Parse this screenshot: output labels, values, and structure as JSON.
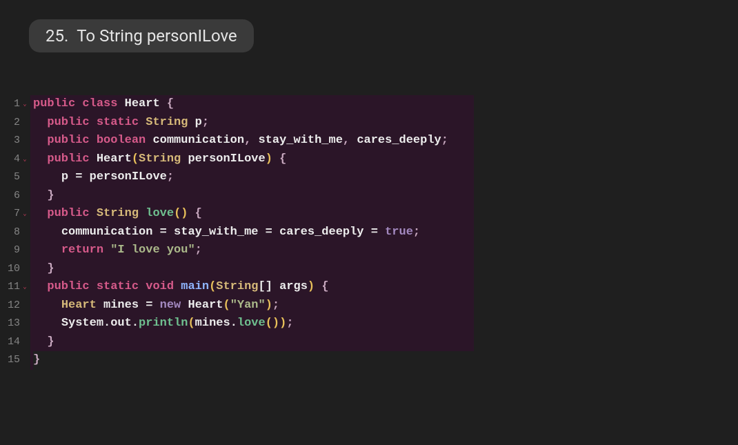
{
  "title": {
    "number": "25.",
    "text": "To String personILove"
  },
  "gutter": {
    "lines": [
      {
        "n": "1",
        "fold": true
      },
      {
        "n": "2",
        "fold": false
      },
      {
        "n": "3",
        "fold": false
      },
      {
        "n": "4",
        "fold": true
      },
      {
        "n": "5",
        "fold": false
      },
      {
        "n": "6",
        "fold": false
      },
      {
        "n": "7",
        "fold": true
      },
      {
        "n": "8",
        "fold": false
      },
      {
        "n": "9",
        "fold": false
      },
      {
        "n": "10",
        "fold": false
      },
      {
        "n": "11",
        "fold": true
      },
      {
        "n": "12",
        "fold": false
      },
      {
        "n": "13",
        "fold": false
      },
      {
        "n": "14",
        "fold": false
      },
      {
        "n": "15",
        "fold": false
      }
    ]
  },
  "code": {
    "l1": {
      "t1": "public",
      "t2": "class",
      "t3": "Heart",
      "t4": "{"
    },
    "l2": {
      "t1": "public",
      "t2": "static",
      "t3": "String",
      "t4": "p",
      "t5": ";"
    },
    "l3": {
      "t1": "public",
      "t2": "boolean",
      "t3": "communication",
      "t4": ",",
      "t5": "stay_with_me",
      "t6": ",",
      "t7": "cares_deeply",
      "t8": ";"
    },
    "l4": {
      "t1": "public",
      "t2": "Heart",
      "t3": "(",
      "t4": "String",
      "t5": "personILove",
      "t6": ")",
      "t7": "{"
    },
    "l5": {
      "t1": "p",
      "t2": "=",
      "t3": "personILove",
      "t4": ";"
    },
    "l6": {
      "t1": "}"
    },
    "l7": {
      "t1": "public",
      "t2": "String",
      "t3": "love",
      "t4": "(",
      "t5": ")",
      "t6": "{"
    },
    "l8": {
      "t1": "communication",
      "t2": "=",
      "t3": "stay_with_me",
      "t4": "=",
      "t5": "cares_deeply",
      "t6": "=",
      "t7": "true",
      "t8": ";"
    },
    "l9": {
      "t1": "return",
      "t2": "\"I love you\"",
      "t3": ";"
    },
    "l10": {
      "t1": "}"
    },
    "l11": {
      "t1": "public",
      "t2": "static",
      "t3": "void",
      "t4": "main",
      "t5": "(",
      "t6": "String",
      "t7": "[]",
      "t8": "args",
      "t9": ")",
      "t10": "{"
    },
    "l12": {
      "t1": "Heart",
      "t2": "mines",
      "t3": "=",
      "t4": "new",
      "t5": "Heart",
      "t6": "(",
      "t7": "\"Yan\"",
      "t8": ")",
      "t9": ";"
    },
    "l13": {
      "t1": "System",
      "t2": ".",
      "t3": "out",
      "t4": ".",
      "t5": "println",
      "t6": "(",
      "t7": "mines",
      "t8": ".",
      "t9": "love",
      "t10": "(",
      "t11": ")",
      "t12": ")",
      "t13": ";"
    },
    "l14": {
      "t1": "}"
    },
    "l15": {
      "t1": "}"
    }
  }
}
